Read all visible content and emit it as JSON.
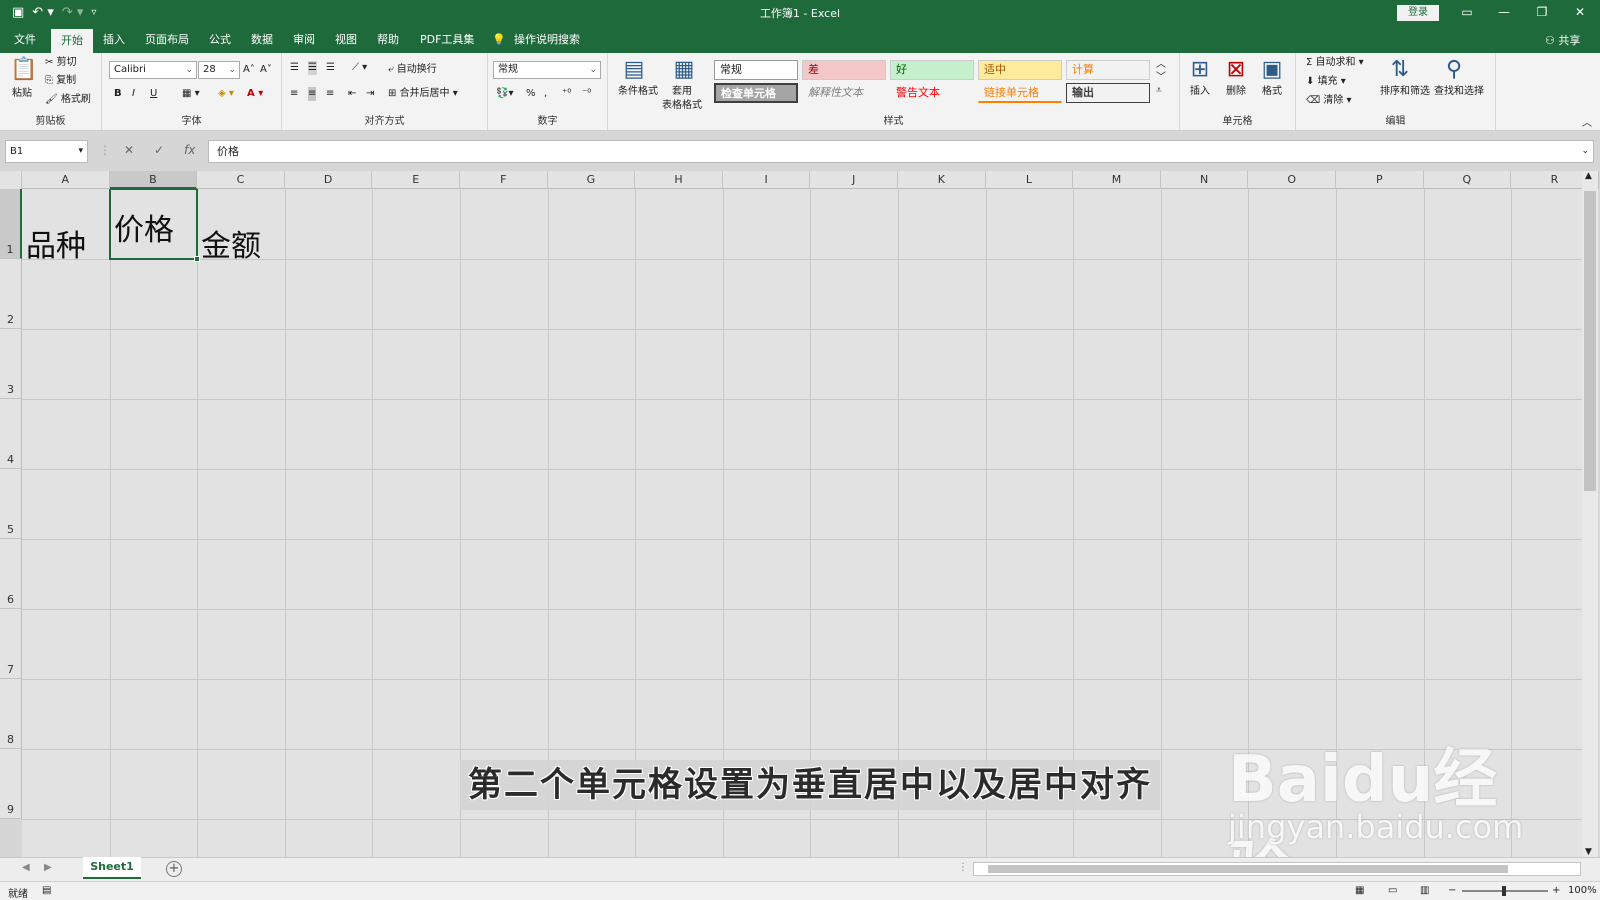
{
  "titlebar": {
    "title": "工作簿1  -  Excel",
    "login": "登录",
    "qat_icons": [
      "save-icon",
      "undo-icon",
      "redo-icon",
      "customize-icon"
    ]
  },
  "tabs": [
    "文件",
    "开始",
    "插入",
    "页面布局",
    "公式",
    "数据",
    "审阅",
    "视图",
    "帮助",
    "PDF工具集"
  ],
  "active_tab": "开始",
  "tell_me": "操作说明搜索",
  "share": "共享",
  "ribbon": {
    "clipboard": {
      "paste": "粘贴",
      "cut": "剪切",
      "copy": "复制",
      "format_painter": "格式刷",
      "label": "剪贴板"
    },
    "font": {
      "name": "Calibri",
      "size": "28",
      "bold": "B",
      "italic": "I",
      "underline": "U",
      "label": "字体"
    },
    "alignment": {
      "wrap": "自动换行",
      "merge": "合并后居中",
      "label": "对齐方式"
    },
    "number": {
      "format": "常规",
      "label": "数字"
    },
    "styles": {
      "conditional": "条件格式",
      "table": "套用\n表格格式",
      "cells": [
        "常规",
        "差",
        "好",
        "适中",
        "计算",
        "检查单元格",
        "解释性文本",
        "警告文本",
        "链接单元格",
        "输出"
      ],
      "label": "样式"
    },
    "cells_group": {
      "insert": "插入",
      "delete": "删除",
      "format": "格式",
      "label": "单元格"
    },
    "editing": {
      "autosum": "自动求和",
      "fill": "填充",
      "clear": "清除",
      "sort": "排序和筛选",
      "find": "查找和选择",
      "label": "编辑"
    }
  },
  "formula_bar": {
    "name_box": "B1",
    "formula": "价格"
  },
  "columns": [
    "A",
    "B",
    "C",
    "D",
    "E",
    "F",
    "G",
    "H",
    "I",
    "J",
    "K",
    "L",
    "M",
    "N",
    "O",
    "P",
    "Q",
    "R"
  ],
  "rows": [
    "1",
    "2",
    "3",
    "4",
    "5",
    "6",
    "7",
    "8",
    "9"
  ],
  "cells": {
    "A1": "品种",
    "B1": "价格",
    "C1": "金额"
  },
  "selected_cell": "B1",
  "caption": "第二个单元格设置为垂直居中以及居中对齐",
  "watermark": {
    "logo": "Baidu经验",
    "url": "jingyan.baidu.com"
  },
  "sheets": [
    "Sheet1"
  ],
  "status": {
    "ready": "就绪",
    "zoom": "100%"
  }
}
